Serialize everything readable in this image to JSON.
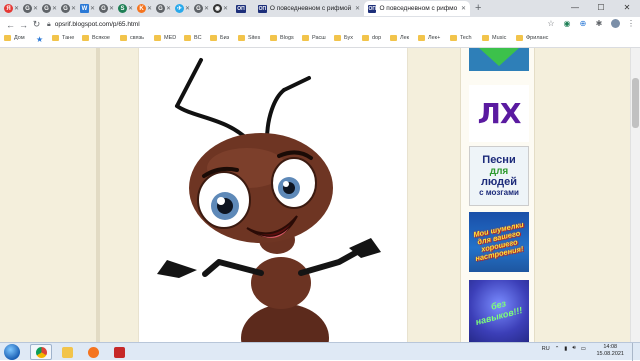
{
  "browser": {
    "tabs_mini": [
      {
        "icon": "yandex-icon",
        "letter": "Я",
        "color": "#e53935"
      },
      {
        "icon": "google-icon",
        "letter": "G",
        "color": "#5f6368"
      },
      {
        "icon": "google-icon",
        "letter": "G",
        "color": "#5f6368"
      },
      {
        "icon": "google-icon",
        "letter": "G",
        "color": "#5f6368"
      },
      {
        "icon": "word-doc-icon",
        "letter": "W",
        "color": "#2b79d6"
      },
      {
        "icon": "google-icon",
        "letter": "G",
        "color": "#5f6368"
      },
      {
        "icon": "green-app-icon",
        "letter": "S",
        "color": "#1e7f55"
      },
      {
        "icon": "orange-app-icon",
        "letter": "K",
        "color": "#f5741f"
      },
      {
        "icon": "google-icon",
        "letter": "G",
        "color": "#5f6368"
      },
      {
        "icon": "telegram-icon",
        "letter": "✈",
        "color": "#29a9eb"
      },
      {
        "icon": "google-icon",
        "letter": "G",
        "color": "#5f6368"
      },
      {
        "icon": "dark-app-icon",
        "letter": "◉",
        "color": "#333333"
      }
    ],
    "tabs_wide": [
      {
        "favicon": "ОП",
        "title": "",
        "active": false
      },
      {
        "favicon": "ОП",
        "title": "О повседневном с рифмой и у",
        "active": false
      },
      {
        "favicon": "ОП",
        "title": "О повседневном с рифмой и у",
        "active": true
      }
    ],
    "new_tab": "+",
    "window_controls": [
      "—",
      "☐",
      "✕"
    ],
    "nav": {
      "back": "←",
      "forward": "→",
      "reload": "↻"
    },
    "url": "opsrif.blogspot.com/p/65.html",
    "bookmarks": [
      {
        "label": "Дом",
        "kind": "folder"
      },
      {
        "label": "",
        "kind": "star"
      },
      {
        "label": "Тане",
        "kind": "folder"
      },
      {
        "label": "Всякое",
        "kind": "folder"
      },
      {
        "label": "связь",
        "kind": "folder"
      },
      {
        "label": "MED",
        "kind": "folder"
      },
      {
        "label": "BC",
        "kind": "folder"
      },
      {
        "label": "Биз",
        "kind": "folder"
      },
      {
        "label": "Sites",
        "kind": "folder"
      },
      {
        "label": "Blogs",
        "kind": "folder"
      },
      {
        "label": "Расш",
        "kind": "folder"
      },
      {
        "label": "Бух",
        "kind": "folder"
      },
      {
        "label": "dop",
        "kind": "folder"
      },
      {
        "label": "Лек",
        "kind": "folder"
      },
      {
        "label": "Лек+",
        "kind": "folder"
      },
      {
        "label": "Tech",
        "kind": "folder"
      },
      {
        "label": "Music",
        "kind": "folder"
      },
      {
        "label": "Фриланс",
        "kind": "folder"
      }
    ]
  },
  "sidebar": {
    "banner_lx": "ЛХ",
    "banner_songs": [
      "Песни",
      "для",
      "людей",
      "с мозгами"
    ],
    "banner_noise": [
      "Мои шумелки",
      "для вашего",
      "хорошего",
      "настроения!"
    ],
    "banner_noise_color": "#ffe23a",
    "banner_bez": [
      "без",
      "навыков!!!"
    ]
  },
  "taskbar": {
    "lang": "RU",
    "time": "14:08",
    "date": "15.08.2021",
    "apps": [
      {
        "icon": "chrome-icon",
        "active": true
      },
      {
        "icon": "file-explorer-icon",
        "active": false
      },
      {
        "icon": "avast-icon",
        "active": false
      },
      {
        "icon": "pdf-app-icon",
        "active": false
      }
    ]
  }
}
